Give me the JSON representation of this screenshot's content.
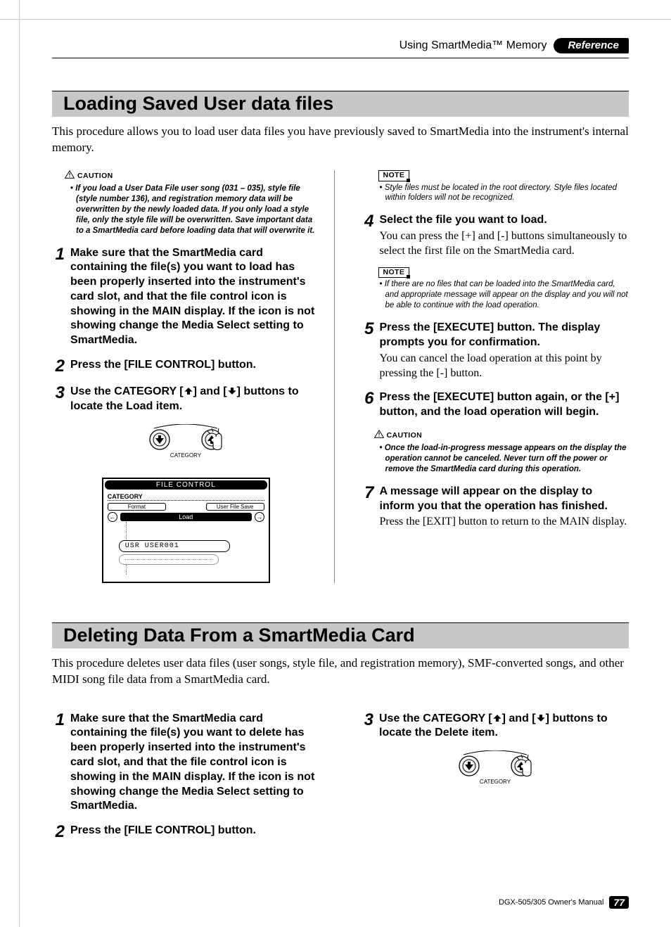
{
  "header": {
    "breadcrumb": "Using SmartMedia™ Memory",
    "pill": "Reference"
  },
  "section1": {
    "title": "Loading Saved User data files",
    "intro": "This procedure allows you to load user data files you have previously saved to SmartMedia into the instrument's internal memory.",
    "caution1_label": "CAUTION",
    "caution1_text": "If you load a User Data File user song (031 – 035), style file (style number 136), and registration memory data will be overwritten by the newly loaded data. If you only load a style file, only the style file will be overwritten. Save important data to a SmartMedia card before loading data that will overwrite it.",
    "step1": "Make sure that the SmartMedia card containing the file(s) you want to load has been properly inserted into the instrument's card slot, and that the file control icon is showing in the MAIN display. If the icon is not showing change the Media Select setting to SmartMedia.",
    "step2": "Press the [FILE CONTROL] button.",
    "step3_a": "Use the CATEGORY [",
    "step3_b": "] and [",
    "step3_c": "] buttons to locate the Load item.",
    "diagram_label": "CATEGORY",
    "lcd": {
      "title": "FILE CONTROL",
      "category": "CATEGORY",
      "tab_left": "Format",
      "tab_right": "User File Save",
      "load": "Load",
      "file": "USR USER001"
    },
    "note1_label": "NOTE",
    "note1_text": "Style files must be located in the root directory. Style files located within folders will not be recognized.",
    "step4_title": "Select the file you want to load.",
    "step4_text": "You can press the [+] and [-] buttons simultaneously to select the first file on the SmartMedia card.",
    "note2_label": "NOTE",
    "note2_text": "If there are no files that can be loaded into the SmartMedia card, and appropriate message will appear on the display and you will not be able to continue with the load operation.",
    "step5_title": "Press the [EXECUTE] button. The display prompts you for confirmation.",
    "step5_text": "You can cancel the load operation at this point by pressing the [-] button.",
    "step6_title": "Press the [EXECUTE] button again, or the [+] button, and the load operation will begin.",
    "caution2_label": "CAUTION",
    "caution2_text": "Once the load-in-progress message appears on the display the operation cannot be canceled. Never turn off the power or remove the SmartMedia card during this operation.",
    "step7_title": "A message will appear on the display to inform you that the operation has finished.",
    "step7_text": "Press the [EXIT] button to return to the MAIN display."
  },
  "section2": {
    "title": "Deleting Data From a SmartMedia Card",
    "intro": "This procedure deletes user data files (user songs, style file, and registration memory), SMF-converted songs, and other MIDI song file data from a SmartMedia card.",
    "step1": "Make sure that the SmartMedia card containing the file(s) you want to delete has been properly inserted into the instrument's card slot, and that the file control icon is showing in the MAIN display. If the icon is not showing change the Media Select setting to SmartMedia.",
    "step2": "Press the [FILE CONTROL] button.",
    "step3_a": "Use the CATEGORY [",
    "step3_b": "] and [",
    "step3_c": "] buttons to locate the Delete item.",
    "diagram_label": "CATEGORY"
  },
  "footer": {
    "text": "DGX-505/305  Owner's Manual",
    "page": "77"
  }
}
